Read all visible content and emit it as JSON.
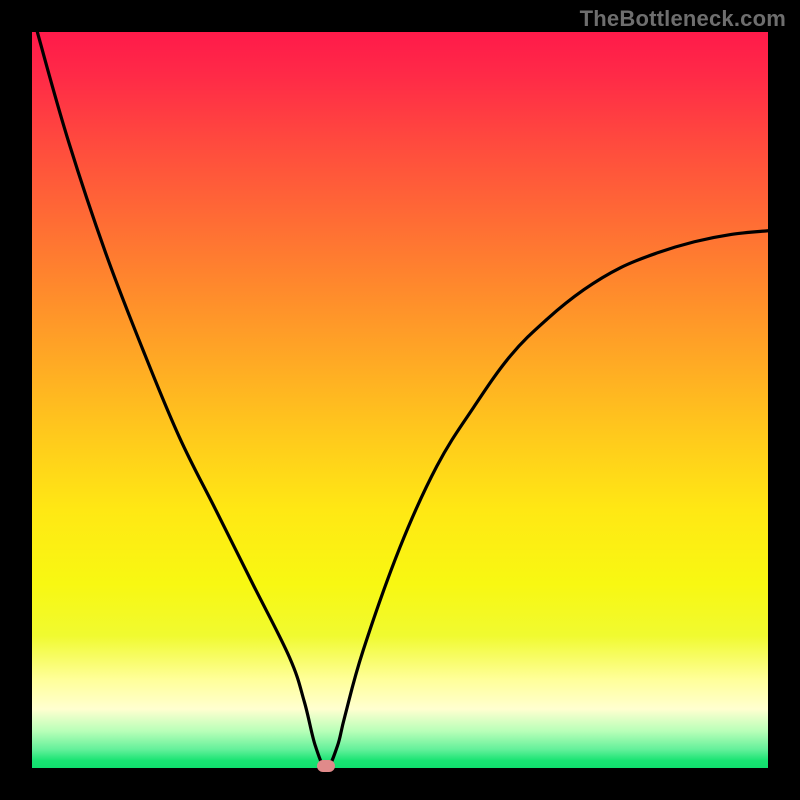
{
  "watermark": "TheBottleneck.com",
  "colors": {
    "frame": "#000000",
    "watermark": "#6e6e6e",
    "curve": "#000000",
    "marker": "#e08a8a",
    "gradient_stops": [
      {
        "offset": 0.0,
        "color": "#ff1a4a"
      },
      {
        "offset": 0.06,
        "color": "#ff2a47"
      },
      {
        "offset": 0.15,
        "color": "#ff4a3e"
      },
      {
        "offset": 0.25,
        "color": "#ff6a35"
      },
      {
        "offset": 0.35,
        "color": "#ff8a2c"
      },
      {
        "offset": 0.45,
        "color": "#ffaa24"
      },
      {
        "offset": 0.55,
        "color": "#ffca1c"
      },
      {
        "offset": 0.65,
        "color": "#ffe814"
      },
      {
        "offset": 0.75,
        "color": "#f8f812"
      },
      {
        "offset": 0.82,
        "color": "#f0fa30"
      },
      {
        "offset": 0.88,
        "color": "#ffff9a"
      },
      {
        "offset": 0.92,
        "color": "#ffffd0"
      },
      {
        "offset": 0.95,
        "color": "#b8ffb8"
      },
      {
        "offset": 0.975,
        "color": "#63f09a"
      },
      {
        "offset": 0.99,
        "color": "#18e472"
      },
      {
        "offset": 1.0,
        "color": "#10df6e"
      }
    ]
  },
  "chart_data": {
    "type": "line",
    "title": "",
    "xlabel": "",
    "ylabel": "",
    "xlim": [
      0,
      100
    ],
    "ylim": [
      0,
      100
    ],
    "grid": false,
    "legend": false,
    "marker": {
      "x": 40,
      "y": 0,
      "shape": "pill",
      "color": "#e08a8a"
    },
    "series": [
      {
        "name": "curve",
        "color": "#000000",
        "x": [
          0,
          1,
          5,
          10,
          15,
          20,
          25,
          30,
          35,
          37,
          38.5,
          40,
          41.5,
          42.5,
          45,
          50,
          55,
          60,
          65,
          70,
          75,
          80,
          85,
          90,
          95,
          100
        ],
        "y": [
          103,
          99,
          85,
          70,
          57,
          45,
          35,
          25,
          15,
          9,
          3,
          0,
          3,
          7,
          16,
          30,
          41,
          49,
          56,
          61,
          65,
          68,
          70,
          71.5,
          72.5,
          73
        ]
      }
    ]
  }
}
